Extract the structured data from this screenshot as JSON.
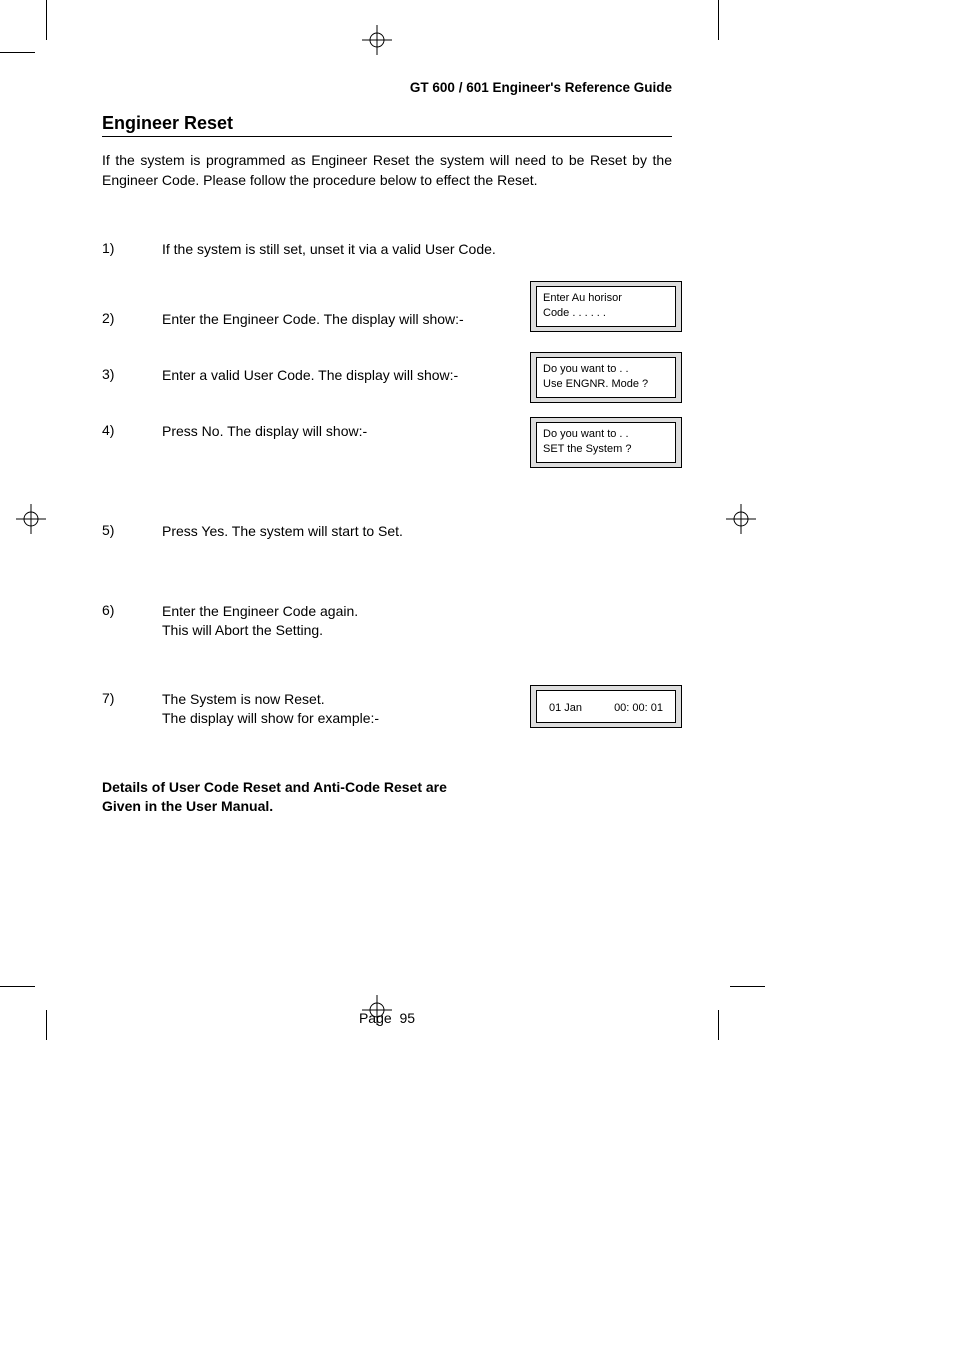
{
  "header": {
    "running": "GT 600 / 601 Engineer's Reference Guide"
  },
  "section": {
    "title": "Engineer Reset",
    "intro": "If the system is programmed as Engineer Reset the system will need to be Reset by the Engineer Code. Please follow the procedure below to effect the Reset."
  },
  "steps": [
    {
      "num": "1)",
      "text": "If the system is still set, unset it via a valid User Code."
    },
    {
      "num": "2)",
      "text": "Enter the Engineer Code. The display will show:-"
    },
    {
      "num": "3)",
      "text": "Enter a valid User Code. The display will show:-"
    },
    {
      "num": "4)",
      "text": "Press No. The display will show:-"
    },
    {
      "num": "5)",
      "text": "Press Yes. The system will start to Set."
    },
    {
      "num": "6)",
      "text": "Enter the Engineer Code again.\nThis will Abort the Setting."
    },
    {
      "num": "7)",
      "text": "The System is now Reset.\nThe display will show for example:-"
    }
  ],
  "lcds": {
    "lcd2": {
      "line1": "Enter Au horisor",
      "line2": "Code . . . . . ."
    },
    "lcd3": {
      "line1": "Do you want to . .",
      "line2": "Use ENGNR. Mode ?"
    },
    "lcd4": {
      "line1": "Do you want to . .",
      "line2": "SET the System ?"
    },
    "lcd7": {
      "date": "01 Jan",
      "time": "00: 00: 01"
    }
  },
  "footerNote": "Details of User Code Reset and Anti-Code Reset are\nGiven in the User Manual.",
  "pageFooter": {
    "label": "Page",
    "number": "95"
  }
}
